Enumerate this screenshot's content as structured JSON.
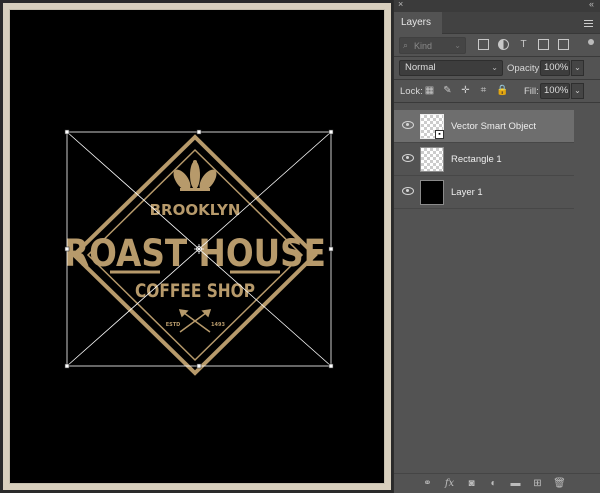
{
  "panel": {
    "tab_label": "Layers",
    "close_glyph": "×",
    "collapse_glyph": "«",
    "kind_placeholder": "Kind",
    "blend_mode": "Normal",
    "opacity_label": "Opacity:",
    "opacity_value": "100%",
    "lock_label": "Lock:",
    "fill_label": "Fill:",
    "fill_value": "100%"
  },
  "layers": [
    {
      "name": "Vector Smart Object",
      "thumb": "checker-smart-object",
      "selected": true
    },
    {
      "name": "Rectangle 1",
      "thumb": "checker",
      "selected": false
    },
    {
      "name": "Layer 1",
      "thumb": "black",
      "selected": false
    }
  ],
  "canvas": {
    "logo_line1": "BROOKLYN",
    "logo_line2": "ROAST HOUSE",
    "logo_line3": "COFFEE SHOP",
    "estd_left": "ESTD",
    "estd_right": "1493",
    "logo_color": "#b79a6b"
  }
}
